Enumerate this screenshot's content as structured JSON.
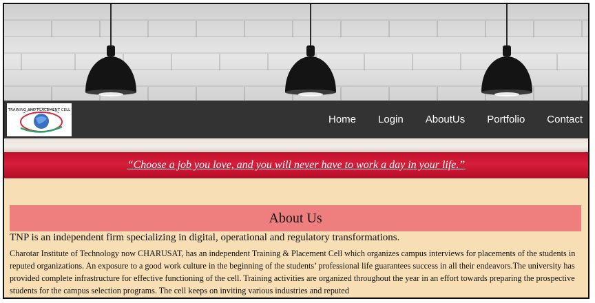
{
  "nav": {
    "logo_text": "TRAINING AND PLACEMENT CELL",
    "items": [
      "Home",
      "Login",
      "AboutUs",
      "Portfolio",
      "Contact"
    ]
  },
  "quote": "“Choose a job you love, and you will never have to work a day in your life.”",
  "about": {
    "title": "About Us",
    "lead": "TNP is an independent firm specializing in digital, operational and regulatory transformations.",
    "body": "Charotar Institute of Technology now CHARUSAT, has an independent Training & Placement Cell which organizes campus interviews for placements of the students in reputed organizations. An exposure to a good work culture in the beginning of the students’ professional life guarantees success in all their endeavors.The university has provided complete infrastructure for effective functioning of the cell. Training activities are organized throughout the year in an effort towards preparing the prospective students for the campus selection programs. The cell keeps on inviting various industries and reputed"
  },
  "colors": {
    "nav_bg": "#333333",
    "quote_bar": "#c8102e",
    "about_header_bg": "#ef7f7f",
    "page_bg": "#f7deb4"
  },
  "icons": [
    "ceiling-lamp-icon",
    "globe-logo-icon"
  ]
}
